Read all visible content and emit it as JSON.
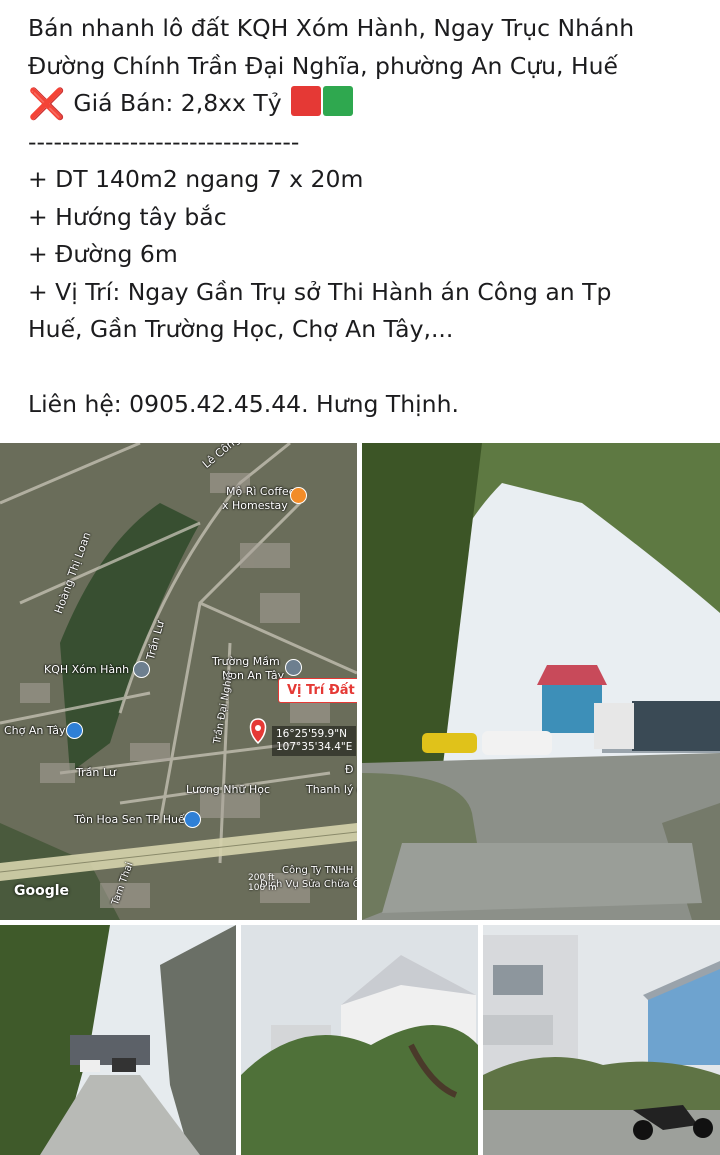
{
  "post": {
    "title_line1": "Bán nhanh lô đất KQH Xóm Hành, Ngay Trục Nhánh",
    "title_line2": "Đường Chính Trần Đại Nghĩa, phường An Cựu, Huế",
    "price": "Giá Bán: 2,8xx Tỷ",
    "separator": "--------------------------------",
    "detail_area": "+ DT 140m2 ngang 7 x 20m",
    "detail_direction": "+ Hướng tây bắc",
    "detail_road": "+ Đường 6m",
    "detail_location_line1": "+ Vị Trí: Ngay Gần Trụ sở Thi Hành án Công an Tp",
    "detail_location_line2": "Huế, Gần Trường Học, Chợ An Tây,...",
    "contact": "Liên hệ: 0905.42.45.44. Hưng Thịnh."
  },
  "emoji": {
    "cross": "❌",
    "square_colors": [
      "#e53935",
      "#2fa84f"
    ]
  },
  "map": {
    "labels": {
      "le_cong_hanh": "Lê Công Hành",
      "mo_ri": "Mộ Rì Coffee",
      "homestay": "x Homestay",
      "hoang_thi_loan": "Hoàng Thị Loan",
      "tran_lu_top": "Trần Lư",
      "kqh": "KQH Xóm Hành",
      "truong_mam_non": "Trường Mầm",
      "non_an_tay": "Non An Tây",
      "tran_dai_nghia": "Trần Đại Nghĩa",
      "cho_an_tay": "Chợ An Tây",
      "tran_lu_bottom": "Trần Lư",
      "luong_nhu_hoc": "Lương Nhữ Học",
      "thanh_ly": "Thanh lý c",
      "ton_hoa_sen": "Tôn Hoa Sen TP Huế",
      "cong_ty": "Công Ty TNHH",
      "dich_vu": "Dịch Vụ Sửa Chữa Ô",
      "tam_thai": "Tam Thai",
      "d": "Đ"
    },
    "pin_label": "Vị Trí Đất",
    "coords_line1": "16°25'59.9\"N",
    "coords_line2": "107°35'34.4\"E",
    "google": "Google",
    "scale_top": "200 ft",
    "scale_bottom": "100 m"
  }
}
